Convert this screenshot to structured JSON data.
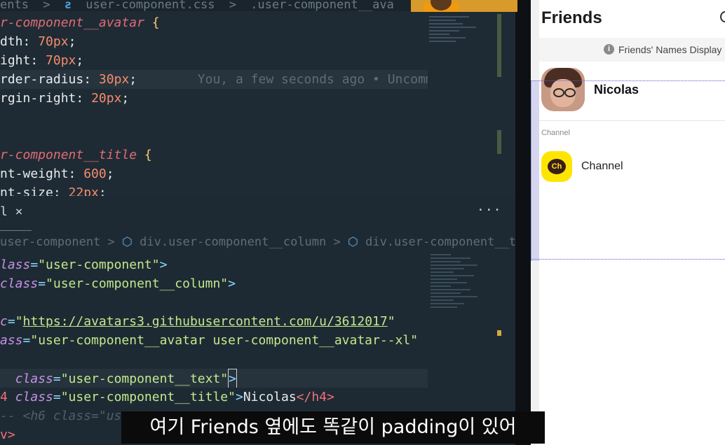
{
  "editor_top": {
    "breadcrumb": [
      "ents",
      ">",
      "user-component.css",
      ">",
      ".user-component__ava"
    ],
    "lines": [
      {
        "selector": "r-component__avatar",
        "brace": "{"
      },
      {
        "prop": "dth:",
        "value": "70px",
        "end": ";"
      },
      {
        "prop": "ight:",
        "value": "70px",
        "end": ";"
      },
      {
        "prop": "rder-radius:",
        "value": "30px",
        "end": ";",
        "blame": "You, a few seconds ago • Uncommit"
      },
      {
        "prop": "rgin-right:",
        "value": "20px",
        "end": ";"
      },
      {
        "selector": "r-component__title",
        "brace": "{"
      },
      {
        "prop": "nt-weight:",
        "value": "600",
        "end": ";"
      },
      {
        "prop": "nt-size:",
        "value": "22px",
        "end": ";"
      }
    ]
  },
  "editor_bottom": {
    "tab_label": "l ×",
    "more_label": "···",
    "breadcrumb": [
      "user-component",
      ">",
      "div.user-component__column",
      ">",
      "div.user-component__text"
    ],
    "lines": {
      "l1_attr": "lass",
      "l1_eq": "=",
      "l1_str": "\"user-component\"",
      "l1_end": ">",
      "l2_attr": "class",
      "l2_eq": "=",
      "l2_str": "\"user-component__column\"",
      "l2_end": ">",
      "l3_attr": "c",
      "l3_eq": "=",
      "l3_q1": "\"",
      "l3_url": "https://avatars3.githubusercontent.com/u/3612017",
      "l3_q2": "\"",
      "l4_attr": "ass",
      "l4_eq": "=",
      "l4_str": "\"user-component__avatar user-component__avatar--xl\"",
      "l5_attr": "class",
      "l5_eq": "=",
      "l5_str": "\"user-component__text\"",
      "l5_end": ">",
      "l6_tag": "4",
      "l6_attr": "class",
      "l6_eq": "=",
      "l6_str": "\"user-component__title\"",
      "l6_gt": ">",
      "l6_text": "Nicolas",
      "l6_close": "</h4>",
      "l7_comment": "-- <h6 class=\"us",
      "l8_text": "v>"
    }
  },
  "app": {
    "title": "Friends",
    "banner_text": "Friends' Names Display",
    "info_glyph": "i",
    "profile_name": "Nicolas",
    "section_label": "Channel",
    "channel_badge": "Ch",
    "channel_name": "Channel"
  },
  "caption": "여기 Friends 옆에도 똑같이 padding이 있어"
}
